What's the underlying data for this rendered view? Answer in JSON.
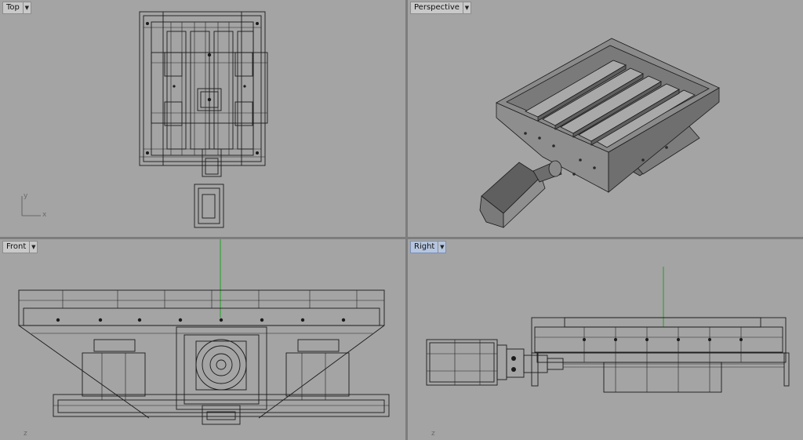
{
  "viewports": {
    "top": {
      "label": "Top",
      "axis_x": "x",
      "axis_y": "y"
    },
    "perspective": {
      "label": "Perspective"
    },
    "front": {
      "label": "Front",
      "axis_z": "z"
    },
    "right": {
      "label": "Right",
      "axis_z": "z"
    }
  },
  "icons": {
    "dropdown": "dropdown-arrow-icon"
  },
  "colors": {
    "viewport_bg": "#a4a4a4",
    "separator": "#7d7d7d",
    "active_tab": "#b6c6df",
    "green_axis": "#1fa01f"
  }
}
